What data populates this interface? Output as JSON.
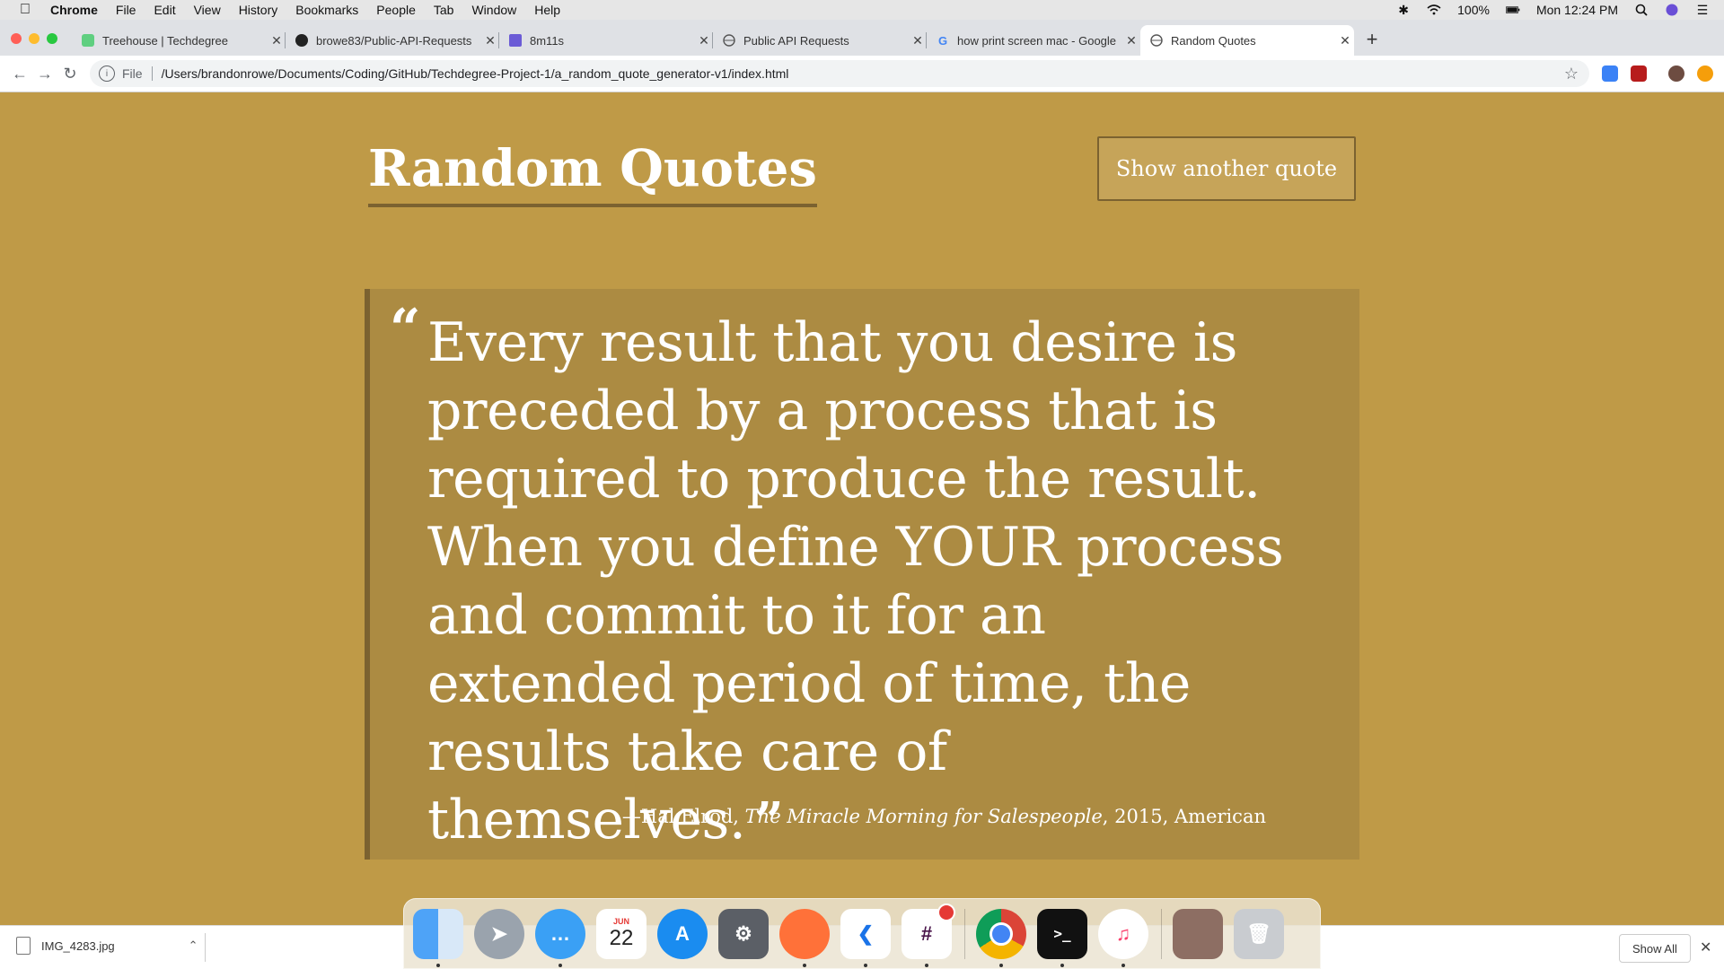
{
  "menubar": {
    "app_name": "Chrome",
    "items": [
      "File",
      "Edit",
      "View",
      "History",
      "Bookmarks",
      "People",
      "Tab",
      "Window",
      "Help"
    ],
    "battery": "100%",
    "clock": "Mon 12:24 PM"
  },
  "tabs": [
    {
      "title": "Treehouse | Techdegree",
      "icon": "treehouse-icon"
    },
    {
      "title": "browe83/Public-API-Requests",
      "icon": "github-icon"
    },
    {
      "title": "8m11s",
      "icon": "site-icon"
    },
    {
      "title": "Public API Requests",
      "icon": "globe-icon"
    },
    {
      "title": "how print screen mac - Google",
      "icon": "google-icon"
    },
    {
      "title": "Random Quotes",
      "icon": "globe-icon",
      "active": true
    }
  ],
  "toolbar": {
    "scheme_label": "File",
    "url": "/Users/brandonrowe/Documents/Coding/GitHub/Techdegree-Project-1/a_random_quote_generator-v1/index.html"
  },
  "page": {
    "title": "Random Quotes",
    "button_label": "Show another quote",
    "quote_text": "Every result that you desire is preceded by a process that is required to produce the result. When you define YOUR process and commit to it for an extended period of time, the results take care of themselves.",
    "open_mark": "“",
    "close_mark": "”",
    "author": "—Hal Elrod, ",
    "citation": "The Miracle Morning for Salespeople",
    "year_and_tag": ", 2015, American"
  },
  "downloads": {
    "file_name": "IMG_4283.jpg",
    "show_all_label": "Show All"
  },
  "dock": {
    "calendar_month": "JUN",
    "calendar_day": "22"
  },
  "colors": {
    "page_bg": "#bf9a47",
    "quote_bg": "#ac8b42",
    "accent": "#7b6230"
  }
}
